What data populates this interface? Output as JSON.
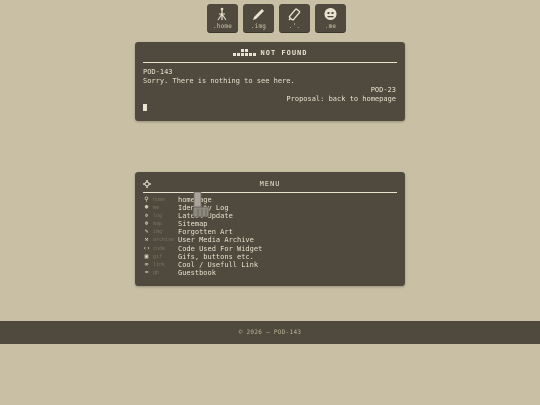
{
  "nav": {
    "buttons": [
      {
        "label": ".home",
        "icon": "antenna-icon"
      },
      {
        "label": ".img",
        "icon": "pencil-icon"
      },
      {
        "label": ".ʼ.",
        "icon": "wrench-icon"
      },
      {
        "label": ".me",
        "icon": "face-icon"
      }
    ]
  },
  "notfound": {
    "title": "NOT FOUND",
    "id": "POD-143",
    "message": "Sorry. There is nothing to see here.",
    "ref": "POD-23",
    "proposal": "Proposal: back to homepage"
  },
  "menu": {
    "title": "MENU",
    "items": [
      {
        "code": "home",
        "name": "homepage",
        "icon": "antenna-icon"
      },
      {
        "code": "me",
        "name": "Identity Log",
        "icon": "face-icon"
      },
      {
        "code": "log",
        "name": "Latest Update",
        "icon": "gear-icon"
      },
      {
        "code": "map",
        "name": "Sitemap",
        "icon": "globe-icon"
      },
      {
        "code": "img",
        "name": "Forgotten Art",
        "icon": "pencil-icon"
      },
      {
        "code": "archive",
        "name": "User Media Archive",
        "icon": "wrench-icon"
      },
      {
        "code": "code",
        "name": "Code Used For Widget",
        "icon": "code-icon"
      },
      {
        "code": "gif",
        "name": "Gifs, buttons etc.",
        "icon": "image-icon"
      },
      {
        "code": "link",
        "name": "Cool / Usefull Link",
        "icon": "link-icon"
      },
      {
        "code": "gb",
        "name": "Guestbook",
        "icon": "book-icon"
      }
    ]
  },
  "footer": {
    "copyright": "© 2026 — POD-143"
  },
  "colors": {
    "background": "#c8bfa4",
    "panel": "#4f4a3d",
    "text": "#e9e3cf"
  }
}
